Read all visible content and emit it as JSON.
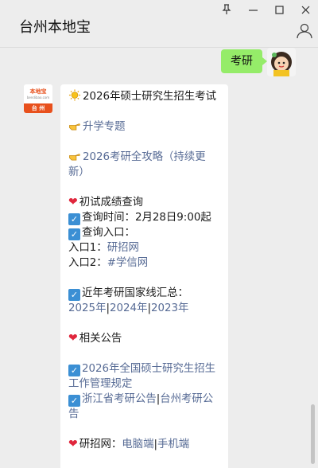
{
  "window": {
    "chat_title": "台州本地宝",
    "pin_glyph": "⊼",
    "min_glyph": "—",
    "max_glyph": "☐",
    "close_glyph": "✕"
  },
  "outgoing": {
    "text": "考研"
  },
  "contact_avatar": {
    "brand": "本地宝",
    "url": "bendibao.com",
    "city": "台 州"
  },
  "message": {
    "title": "2026年硕士研究生招生考试",
    "link1": "升学专题",
    "link2": "2026考研全攻略（持续更新）",
    "s1_title": "初试成绩查询",
    "s1_time": "查询时间：2月28日9:00起",
    "s1_entry": "查询入口：",
    "entry1_label": "入口1：",
    "entry1_link": "研招网",
    "entry2_label": "入口2：",
    "entry2_link": "#学信网",
    "s2_title": "近年考研国家线汇总：",
    "year1": "2025年",
    "year2": "2024年",
    "year3": "2023年",
    "sep": "|",
    "s3_title": "相关公告",
    "notice1": "2026年全国硕士研究生招生工作管理规定",
    "notice2a": "浙江省考研公告",
    "notice2b": "台州考研公告",
    "s4_label": "研招网：",
    "s4_link1": "电脑端",
    "s4_link2": "手机端"
  },
  "colors": {
    "link": "#576b95",
    "my_bubble": "#95ec69",
    "heart": "#e0263c",
    "check": "#3b8fd4",
    "brand": "#e8501c"
  },
  "icons": {
    "sun": "sun-icon",
    "pointing": "pointing-hand-icon",
    "heart": "heart-icon",
    "check": "check-box-icon"
  }
}
